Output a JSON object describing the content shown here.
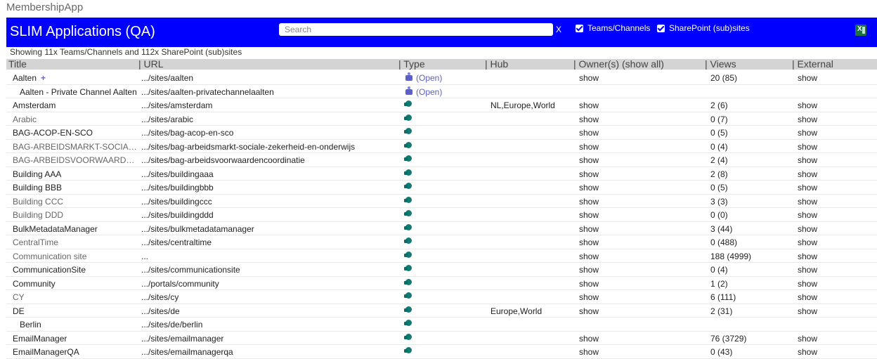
{
  "app_title": "MembershipApp",
  "header": {
    "title": "SLIM Applications (QA)",
    "search_placeholder": "Search",
    "clear_label": "X",
    "filter_teams_label": "Teams/Channels",
    "filter_sharepoint_label": "SharePoint (sub)sites",
    "colors": {
      "banner": "#0000ff"
    }
  },
  "summary": "Showing 11x Teams/Channels and 112x SharePoint (sub)sites",
  "columns": {
    "title": "Title",
    "url": "| URL",
    "type": "| Type",
    "hub": "| Hub",
    "owners": "| Owner(s) (show all)",
    "views": "| Views",
    "external": "| External"
  },
  "rows": [
    {
      "title": "Aalten",
      "url": ".../sites/aalten",
      "type": "teams",
      "open": "(Open)",
      "hub": "",
      "owners": "show",
      "views": "20 (85)",
      "external": "show",
      "plus": "+",
      "sub": false,
      "muted": false
    },
    {
      "title": "Aalten - Private Channel Aalten",
      "url": ".../sites/aalten-privatechannelaalten",
      "type": "teams",
      "open": "(Open)",
      "hub": "",
      "owners": "",
      "views": "",
      "external": "",
      "sub": true,
      "muted": false
    },
    {
      "title": "Amsterdam",
      "url": ".../sites/amsterdam",
      "type": "sharepoint",
      "hub": "NL,Europe,World",
      "owners": "show",
      "views": "2 (6)",
      "external": "show",
      "sub": false,
      "muted": false
    },
    {
      "title": "Arabic",
      "url": ".../sites/arabic",
      "type": "sharepoint",
      "hub": "",
      "owners": "show",
      "views": "0 (7)",
      "external": "show",
      "sub": false,
      "muted": true
    },
    {
      "title": "BAG-ACOP-EN-SCO",
      "url": ".../sites/bag-acop-en-sco",
      "type": "sharepoint",
      "hub": "",
      "owners": "show",
      "views": "0 (5)",
      "external": "show",
      "sub": false,
      "muted": false
    },
    {
      "title": "BAG-ARBEIDSMARKT-SOCIALE-...",
      "url": ".../sites/bag-arbeidsmarkt-sociale-zekerheid-en-onderwijs",
      "type": "sharepoint",
      "hub": "",
      "owners": "show",
      "views": "0 (4)",
      "external": "show",
      "sub": false,
      "muted": true
    },
    {
      "title": "BAG-ARBEIDSVOORWAARDEN...",
      "url": ".../sites/bag-arbeidsvoorwaardencoordinatie",
      "type": "sharepoint",
      "hub": "",
      "owners": "show",
      "views": "2 (4)",
      "external": "show",
      "sub": false,
      "muted": true
    },
    {
      "title": "Building AAA",
      "url": ".../sites/buildingaaa",
      "type": "sharepoint",
      "hub": "",
      "owners": "show",
      "views": "2 (8)",
      "external": "show",
      "sub": false,
      "muted": false
    },
    {
      "title": "Building BBB",
      "url": ".../sites/buildingbbb",
      "type": "sharepoint",
      "hub": "",
      "owners": "show",
      "views": "0 (5)",
      "external": "show",
      "sub": false,
      "muted": false
    },
    {
      "title": "Building CCC",
      "url": ".../sites/buildingccc",
      "type": "sharepoint",
      "hub": "",
      "owners": "show",
      "views": "3 (3)",
      "external": "show",
      "sub": false,
      "muted": true
    },
    {
      "title": "Building DDD",
      "url": ".../sites/buildingddd",
      "type": "sharepoint",
      "hub": "",
      "owners": "show",
      "views": "0 (0)",
      "external": "show",
      "sub": false,
      "muted": true
    },
    {
      "title": "BulkMetadataManager",
      "url": ".../sites/bulkmetadatamanager",
      "type": "sharepoint",
      "hub": "",
      "owners": "show",
      "views": "3 (44)",
      "external": "show",
      "sub": false,
      "muted": false
    },
    {
      "title": "CentralTime",
      "url": ".../sites/centraltime",
      "type": "sharepoint",
      "hub": "",
      "owners": "show",
      "views": "0 (488)",
      "external": "show",
      "sub": false,
      "muted": true
    },
    {
      "title": "Communication site",
      "url": "...",
      "type": "sharepoint",
      "hub": "",
      "owners": "show",
      "views": "188 (4999)",
      "external": "show",
      "sub": false,
      "muted": true
    },
    {
      "title": "CommunicationSite",
      "url": ".../sites/communicationsite",
      "type": "sharepoint",
      "hub": "",
      "owners": "show",
      "views": "0 (4)",
      "external": "show",
      "sub": false,
      "muted": false
    },
    {
      "title": "Community",
      "url": ".../portals/community",
      "type": "sharepoint",
      "hub": "",
      "owners": "show",
      "views": "1 (2)",
      "external": "show",
      "sub": false,
      "muted": false
    },
    {
      "title": "CY",
      "url": ".../sites/cy",
      "type": "sharepoint",
      "hub": "",
      "owners": "show",
      "views": "6 (111)",
      "external": "show",
      "sub": false,
      "muted": true
    },
    {
      "title": "DE",
      "url": ".../sites/de",
      "type": "sharepoint",
      "hub": "Europe,World",
      "owners": "show",
      "views": "2 (31)",
      "external": "show",
      "sub": false,
      "muted": false
    },
    {
      "title": "Berlin",
      "url": ".../sites/de/berlin",
      "type": "sharepoint",
      "hub": "",
      "owners": "",
      "views": "",
      "external": "",
      "sub": true,
      "muted": false
    },
    {
      "title": "EmailManager",
      "url": ".../sites/emailmanager",
      "type": "sharepoint",
      "hub": "",
      "owners": "show",
      "views": "76 (3729)",
      "external": "show",
      "sub": false,
      "muted": false
    },
    {
      "title": "EmailManagerQA",
      "url": ".../sites/emailmanagerqa",
      "type": "sharepoint",
      "hub": "",
      "owners": "show",
      "views": "0 (43)",
      "external": "show",
      "sub": false,
      "muted": false
    }
  ]
}
